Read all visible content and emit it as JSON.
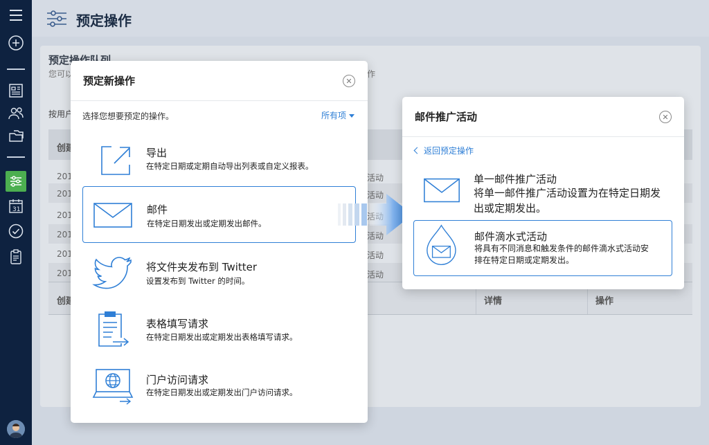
{
  "page": {
    "title": "预定操作"
  },
  "background": {
    "card_title": "预定操作队列",
    "card_subtitle_left": "您可以",
    "card_subtitle_right": "作",
    "filter_label": "按用户",
    "table_header_first": "创建",
    "rows": [
      "201",
      "201",
      "201",
      "201",
      "201",
      "201"
    ],
    "row_action": "活动",
    "table2_first": "创建",
    "table2_details": "详情",
    "table2_actions": "操作"
  },
  "modal_left": {
    "title": "预定新操作",
    "prompt": "选择您想要预定的操作。",
    "filter": "所有项",
    "options": [
      {
        "title": "导出",
        "desc": "在特定日期或定期自动导出列表或自定义报表。",
        "icon": "export-icon"
      },
      {
        "title": "邮件",
        "desc": "在特定日期发出或定期发出邮件。",
        "icon": "mail-icon"
      },
      {
        "title": "将文件夹发布到 Twitter",
        "desc": "设置发布到 Twitter 的时间。",
        "icon": "twitter-icon"
      },
      {
        "title": "表格填写请求",
        "desc": "在特定日期发出或定期发出表格填写请求。",
        "icon": "clipboard-form-icon"
      },
      {
        "title": "门户访问请求",
        "desc": "在特定日期发出或定期发出门户访问请求。",
        "icon": "portal-globe-icon"
      }
    ]
  },
  "modal_right": {
    "title": "邮件推广活动",
    "back_label": "返回预定操作",
    "options": [
      {
        "title": "单一邮件推广活动",
        "desc": "将单一邮件推广活动设置为在特定日期发出或定期发出。",
        "icon": "mail-icon"
      },
      {
        "title": "邮件滴水式活动",
        "desc": "将具有不同消息和触发条件的邮件滴水式活动安排在特定日期或定期发出。",
        "icon": "drip-mail-icon"
      }
    ]
  },
  "colors": {
    "accent": "#2f7fd6",
    "sidebar": "#0e2240",
    "active": "#4caf50"
  }
}
